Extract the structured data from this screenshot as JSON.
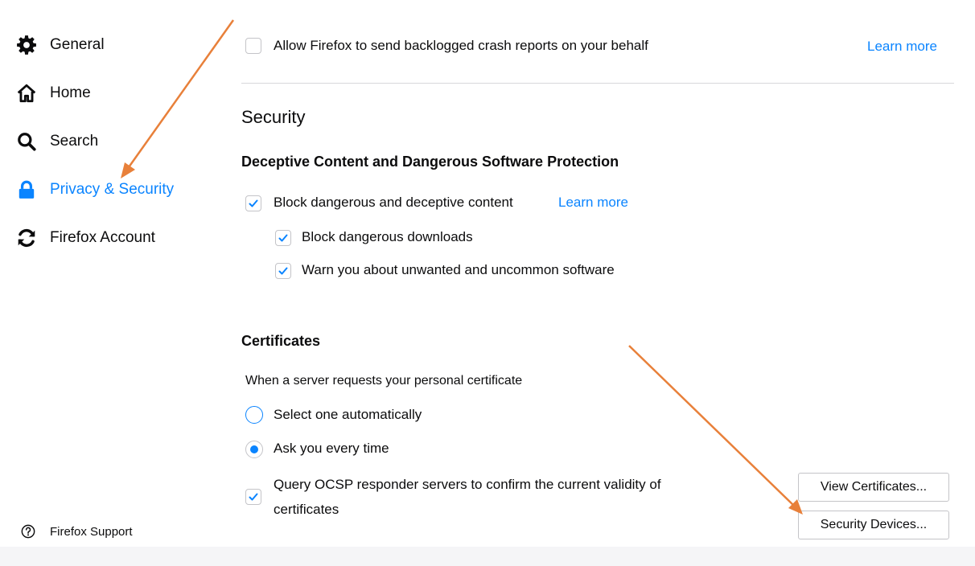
{
  "sidebar": {
    "items": [
      {
        "label": "General",
        "icon": "gear-icon",
        "active": false
      },
      {
        "label": "Home",
        "icon": "home-icon",
        "active": false
      },
      {
        "label": "Search",
        "icon": "search-icon",
        "active": false
      },
      {
        "label": "Privacy & Security",
        "icon": "lock-icon",
        "active": true
      },
      {
        "label": "Firefox Account",
        "icon": "sync-icon",
        "active": false
      }
    ],
    "support_label": "Firefox Support",
    "support_icon": "help-icon"
  },
  "crash_reports": {
    "label": "Allow Firefox to send backlogged crash reports on your behalf",
    "checked": false,
    "learn_more": "Learn more"
  },
  "security": {
    "title": "Security",
    "protection": {
      "heading": "Deceptive Content and Dangerous Software Protection",
      "block_content": {
        "label": "Block dangerous and deceptive content",
        "checked": true,
        "learn_more": "Learn more"
      },
      "block_downloads": {
        "label": "Block dangerous downloads",
        "checked": true
      },
      "warn_unwanted": {
        "label": "Warn you about unwanted and uncommon software",
        "checked": true
      }
    },
    "certificates": {
      "heading": "Certificates",
      "prompt": "When a server requests your personal certificate",
      "options": [
        {
          "label": "Select one automatically",
          "checked": false
        },
        {
          "label": "Ask you every time",
          "checked": true
        }
      ],
      "ocsp": {
        "label_line1": "Query OCSP responder servers to confirm the current validity of",
        "label_line2": "certificates",
        "checked": true
      },
      "view_button": "View Certificates...",
      "devices_button": "Security Devices..."
    }
  },
  "colors": {
    "accent": "#0a84ff",
    "annotation_arrow": "#e8803a"
  }
}
